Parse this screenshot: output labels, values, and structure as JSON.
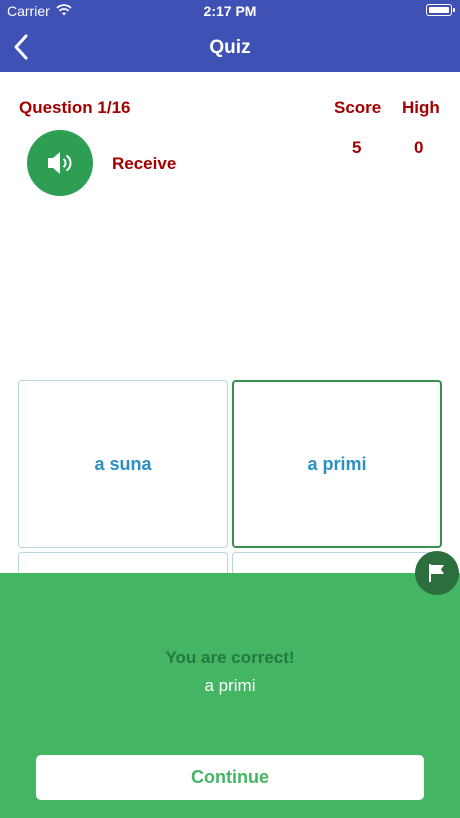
{
  "status_bar": {
    "carrier": "Carrier",
    "time": "2:17 PM"
  },
  "nav": {
    "title": "Quiz",
    "back_icon": "chevron-left-icon"
  },
  "quiz": {
    "question_label": "Question 1/16",
    "score_label": "Score",
    "high_label": "High",
    "score_value": "5",
    "high_value": "0",
    "prompt_word": "Receive",
    "speaker_icon": "speaker-icon"
  },
  "options": [
    {
      "label": "a suna",
      "selected": false
    },
    {
      "label": "a primi",
      "selected": true
    },
    {
      "label": "",
      "selected": false
    },
    {
      "label": "",
      "selected": false
    }
  ],
  "result": {
    "title": "You are correct!",
    "answer": "a primi",
    "continue_label": "Continue",
    "flag_icon": "flag-icon"
  },
  "colors": {
    "nav_bg": "#3f51b5",
    "accent_red": "#a30000",
    "option_text": "#2a8fc1",
    "success_green": "#44b563",
    "speaker_green": "#2e9e52"
  }
}
